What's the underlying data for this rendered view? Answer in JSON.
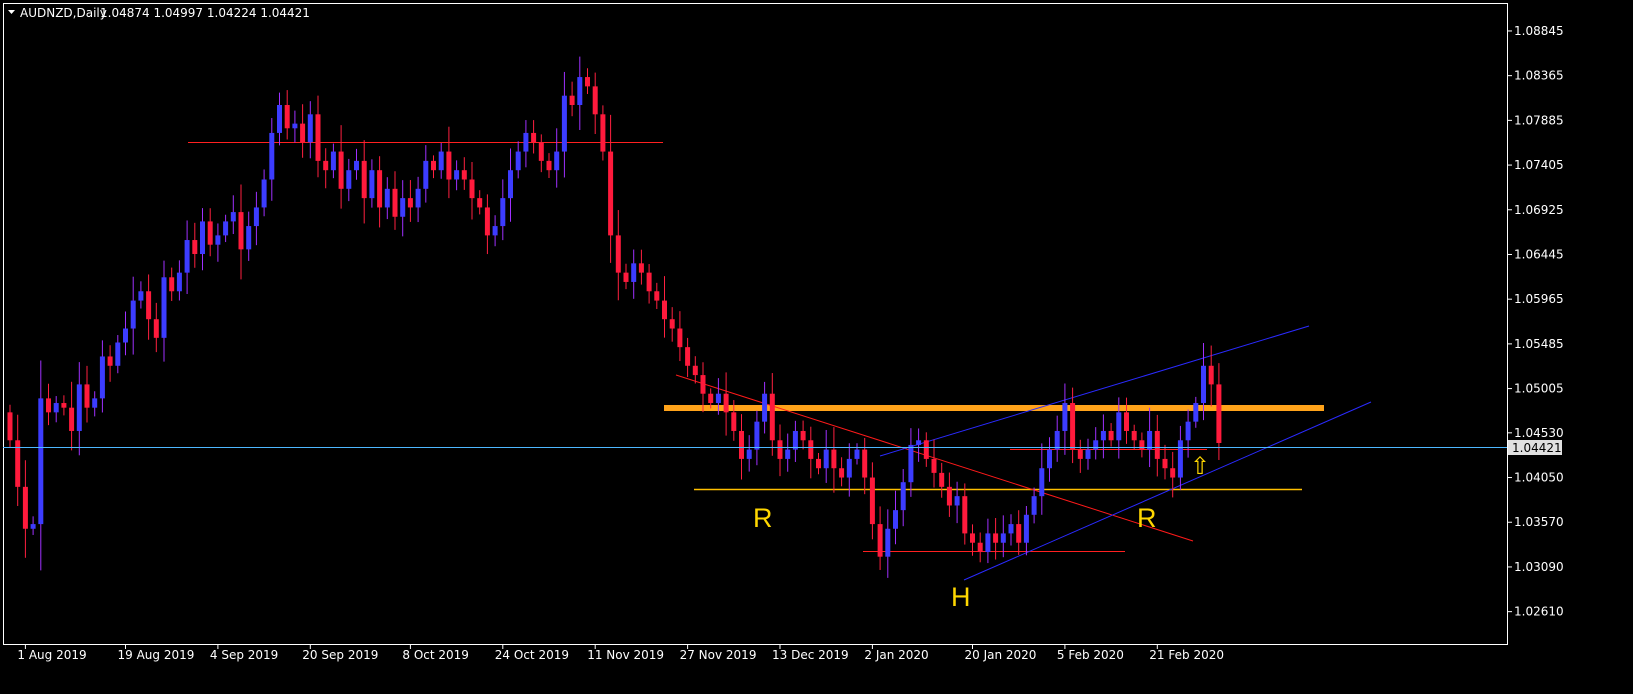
{
  "header": {
    "symbol_label": "AUDNZD,Daily",
    "ohlc_label": "1.04874 1.04997 1.04224 1.04421"
  },
  "colors": {
    "background": "#000000",
    "axis": "#ffffff",
    "bull": "#3c3cff",
    "bear": "#ff1a3c",
    "wick_bull": "#9f30ff",
    "wick_bear": "#ff2040",
    "trendline_red": "#ff1a1a",
    "channel_blue": "#2a2aff",
    "resistance": "#ffa31a",
    "neckline": "#ffc000",
    "current_line": "#4db8ff",
    "price_tag_bg": "#e0e0e0",
    "annotation": "#ffd700",
    "arrow": "#ffd700"
  },
  "chart_data": {
    "type": "candlestick",
    "symbol": "AUDNZD",
    "timeframe": "Daily",
    "ylim": [
      1.0237,
      1.0907
    ],
    "y_ticks": [
      "1.08845",
      "1.08365",
      "1.07885",
      "1.07405",
      "1.06925",
      "1.06445",
      "1.05965",
      "1.05485",
      "1.05005",
      "1.04530",
      "1.04050",
      "1.03570",
      "1.03090",
      "1.02610"
    ],
    "x_labels": [
      {
        "label": "1 Aug 2019",
        "bar": 2
      },
      {
        "label": "19 Aug 2019",
        "bar": 15
      },
      {
        "label": "4 Sep 2019",
        "bar": 27
      },
      {
        "label": "20 Sep 2019",
        "bar": 39
      },
      {
        "label": "8 Oct 2019",
        "bar": 52
      },
      {
        "label": "24 Oct 2019",
        "bar": 64
      },
      {
        "label": "11 Nov 2019",
        "bar": 76
      },
      {
        "label": "27 Nov 2019",
        "bar": 88
      },
      {
        "label": "13 Dec 2019",
        "bar": 100
      },
      {
        "label": "2 Jan 2020",
        "bar": 112
      },
      {
        "label": "20 Jan 2020",
        "bar": 125
      },
      {
        "label": "5 Feb 2020",
        "bar": 137
      },
      {
        "label": "21 Feb 2020",
        "bar": 149
      }
    ],
    "current_price": 1.04421,
    "current_price_label": "1.04421",
    "closes": [
      1.0445,
      1.0395,
      1.035,
      1.0355,
      1.049,
      1.0475,
      1.0485,
      1.048,
      1.0455,
      1.0505,
      1.048,
      1.049,
      1.0535,
      1.0525,
      1.055,
      1.0565,
      1.0595,
      1.0605,
      1.0575,
      1.0555,
      1.062,
      1.0605,
      1.0625,
      1.066,
      1.0645,
      1.068,
      1.0655,
      1.0665,
      1.068,
      1.069,
      1.065,
      1.0675,
      1.0695,
      1.0725,
      1.0775,
      1.0805,
      1.078,
      1.0785,
      1.0765,
      1.0795,
      1.0745,
      1.0735,
      1.0755,
      1.0715,
      1.0735,
      1.0745,
      1.0705,
      1.0735,
      1.0695,
      1.0715,
      1.0685,
      1.0705,
      1.0695,
      1.0715,
      1.0745,
      1.0735,
      1.0755,
      1.0725,
      1.0735,
      1.0725,
      1.0705,
      1.0695,
      1.0665,
      1.0675,
      1.0705,
      1.0735,
      1.0755,
      1.0775,
      1.0765,
      1.0745,
      1.0735,
      1.0755,
      1.0815,
      1.0805,
      1.0835,
      1.0825,
      1.0795,
      1.0755,
      1.0665,
      1.0625,
      1.0615,
      1.0635,
      1.0625,
      1.0605,
      1.0595,
      1.0575,
      1.0565,
      1.0545,
      1.0525,
      1.0515,
      1.0495,
      1.0485,
      1.0495,
      1.0475,
      1.0455,
      1.0425,
      1.0435,
      1.0465,
      1.0495,
      1.0445,
      1.0425,
      1.0435,
      1.0455,
      1.0445,
      1.0425,
      1.0415,
      1.0435,
      1.0415,
      1.0405,
      1.0425,
      1.0435,
      1.0405,
      1.0355,
      1.032,
      1.035,
      1.037,
      1.04,
      1.044,
      1.0445,
      1.0425,
      1.041,
      1.0395,
      1.0375,
      1.0385,
      1.0345,
      1.0335,
      1.0325,
      1.0345,
      1.0335,
      1.0345,
      1.0355,
      1.0335,
      1.0365,
      1.0385,
      1.0415,
      1.0435,
      1.0455,
      1.0485,
      1.0435,
      1.0425,
      1.0435,
      1.0445,
      1.0455,
      1.0445,
      1.0475,
      1.0455,
      1.0445,
      1.0435,
      1.0455,
      1.0425,
      1.0415,
      1.0405,
      1.0445,
      1.0465,
      1.0485,
      1.0525,
      1.0505,
      1.04421
    ]
  },
  "annotations": {
    "r_left": "R",
    "h_mid": "H",
    "r_right": "R",
    "arrow": "⇧"
  }
}
